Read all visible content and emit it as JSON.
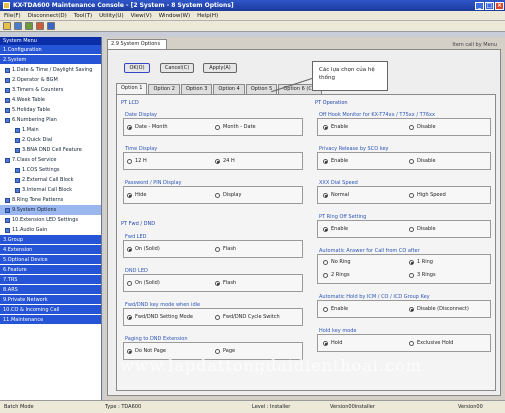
{
  "window": {
    "title": "KX-TDA600 Maintenance Console - [2 System - 8 System Options]",
    "minimize": "_",
    "maximize": "□",
    "close": "×"
  },
  "menu": [
    "File(F)",
    "Disconnect(D)",
    "Tool(T)",
    "Utility(U)",
    "View(V)",
    "Window(W)",
    "Help(H)"
  ],
  "toolbar": {
    "icons": [
      "open-icon",
      "save-icon",
      "print-icon",
      "connect-icon",
      "help-icon"
    ],
    "colors": [
      "#e8c048",
      "#4a7fd0",
      "#6a9a3a",
      "#d05a3a",
      "#3a66c8"
    ]
  },
  "left_panel": {
    "header": "System Menu",
    "groups_top": [
      {
        "label": "1.Configuration"
      },
      {
        "label": "2.System"
      }
    ],
    "tree": [
      {
        "label": "1.Date & Time / Daylight Saving",
        "indent": 0
      },
      {
        "label": "2.Operator & BGM",
        "indent": 0
      },
      {
        "label": "3.Timers & Counters",
        "indent": 0
      },
      {
        "label": "4.Week Table",
        "indent": 0
      },
      {
        "label": "5.Holiday Table",
        "indent": 0
      },
      {
        "label": "6.Numbering Plan",
        "indent": 0
      },
      {
        "label": "1.Main",
        "indent": 1
      },
      {
        "label": "2.Quick Dial",
        "indent": 1
      },
      {
        "label": "3.BNA DND Cell Feature",
        "indent": 1
      },
      {
        "label": "7.Class of Service",
        "indent": 0
      },
      {
        "label": "1.COS Settings",
        "indent": 1
      },
      {
        "label": "2.External Call Block",
        "indent": 1
      },
      {
        "label": "3.Internal Call Block",
        "indent": 1
      },
      {
        "label": "8.Ring Tone Patterns",
        "indent": 0
      },
      {
        "label": "9.System Options",
        "indent": 0,
        "selected": true
      },
      {
        "label": "10.Extension LED Settings",
        "indent": 0
      },
      {
        "label": "11.Audio Gain",
        "indent": 0
      }
    ],
    "groups_bottom": [
      {
        "label": "3.Group"
      },
      {
        "label": "4.Extension"
      },
      {
        "label": "5.Optional Device"
      },
      {
        "label": "6.Feature"
      },
      {
        "label": "7.TRS"
      },
      {
        "label": "8.ARS"
      },
      {
        "label": "9.Private Network"
      },
      {
        "label": "10.CO & Incoming Call"
      },
      {
        "label": "11.Maintenance"
      }
    ]
  },
  "doc_tab": "2.9 System Options",
  "top_right_label": "Item call by Menu",
  "buttons": {
    "ok": "OK(O)",
    "cancel": "Cancel(C)",
    "apply": "Apply(A)"
  },
  "tabs": [
    "Option 1",
    "Option 2",
    "Option 3",
    "Option 4",
    "Option 5",
    "Option 6 (CS)"
  ],
  "callout": {
    "line1": "Các lựa chọn của hệ",
    "line2": "thống"
  },
  "sections": {
    "pt_lcd": "PT LCD",
    "pt_fwd_dnd": "PT Fwd / DND",
    "pt_operation": "PT Operation"
  },
  "fields": {
    "date_display": {
      "label": "Date Display",
      "opt1": "Date - Month",
      "opt2": "Month - Date"
    },
    "time_display": {
      "label": "Time Display",
      "opt1": "12 H",
      "opt2": "24 H"
    },
    "password_pin": {
      "label": "Password / PIN Display",
      "opt1": "Hide",
      "opt2": "Display"
    },
    "fwd_led": {
      "label": "Fwd LED",
      "opt1": "On (Solid)",
      "opt2": "Flash"
    },
    "dnd_led": {
      "label": "DND LED",
      "opt1": "On (Solid)",
      "opt2": "Flash"
    },
    "fwd_dnd_key": {
      "label": "Fwd/DND key mode when idle",
      "opt1": "Fwd/DND Setting Mode",
      "opt2": "Fwd/DND Cycle Switch"
    },
    "paging_dnd": {
      "label": "Paging to DND Extension",
      "opt1": "Do Not Page",
      "opt2": "Page"
    },
    "off_hook": {
      "label": "Off Hook Monitor for KX-T74xx / T75xx / T76xx",
      "opt1": "Enable",
      "opt2": "Disable"
    },
    "privacy_release": {
      "label": "Privacy Release by SCO key",
      "opt1": "Enable",
      "opt2": "Disable"
    },
    "xxx_dial_speed": {
      "label": "XXX Dial Speed",
      "opt1": "Normal",
      "opt2": "High Speed"
    },
    "pt_ring_off": {
      "label": "PT Ring Off Setting",
      "opt1": "Enable",
      "opt2": "Disable"
    },
    "auto_answer": {
      "label": "Automatic Answer for Call from CO after",
      "opt1": "No Ring",
      "opt2": "1 Ring",
      "opt3": "2 Rings",
      "opt4": "3 Rings"
    },
    "auto_hold": {
      "label": "Automatic Hold by ICM / CO / ICD Group Key",
      "opt1": "Enable",
      "opt2": "Disable (Disconnect)"
    },
    "hold_key": {
      "label": "Hold key mode",
      "opt1": "Hold",
      "opt2": "Exclusive Hold"
    }
  },
  "watermark": "www.lapdattongdaidienthoai.com",
  "statusbar": {
    "mode": "Batch Mode",
    "type": "Type : TDA600",
    "level": "Level : Installer",
    "version1": "Version00installer",
    "version2": "Version00"
  }
}
